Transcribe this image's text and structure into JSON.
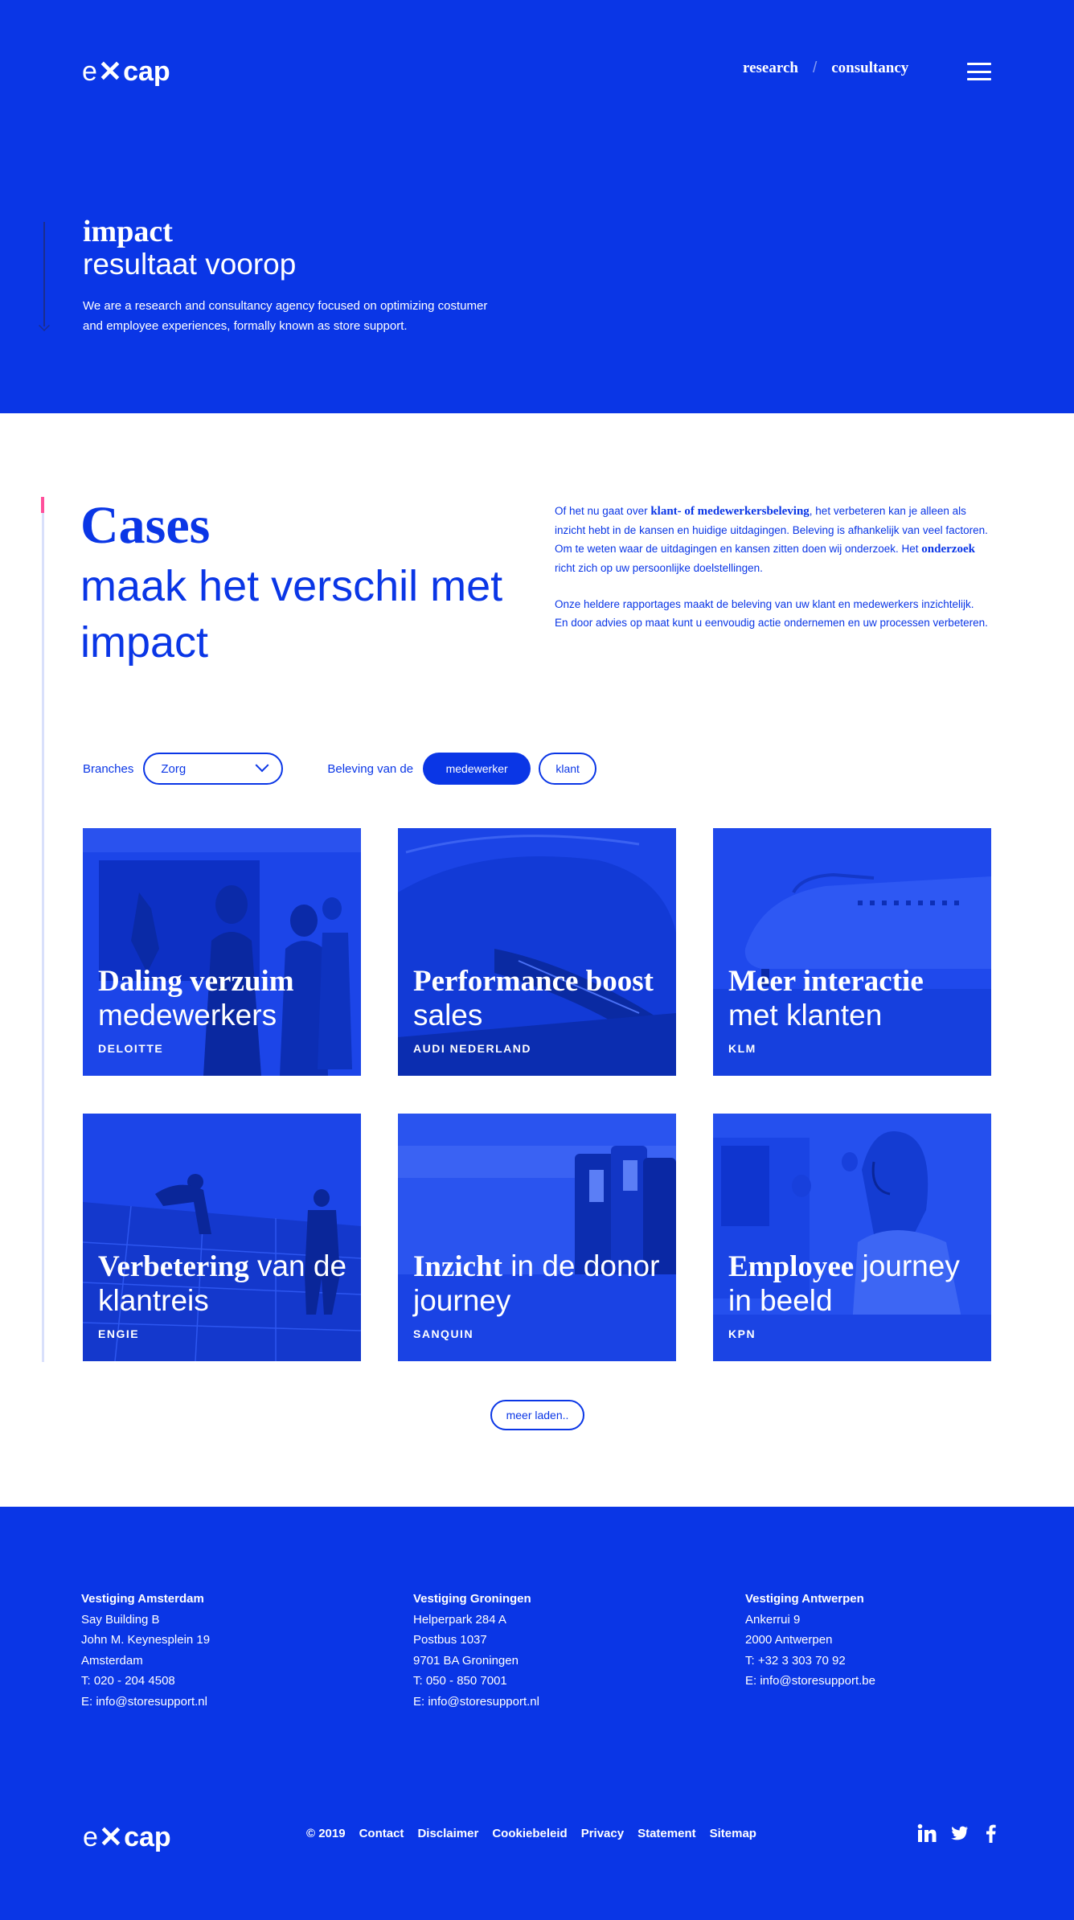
{
  "header": {
    "logo": {
      "e": "e",
      "x": "✕",
      "cap": "cap"
    },
    "nav": [
      {
        "label": "research"
      },
      {
        "label": "consultancy"
      }
    ],
    "nav_separator": "/"
  },
  "hero": {
    "title": "impact",
    "subtitle": "resultaat voorop",
    "text": "We are a research and consultancy agency focused on optimizing costumer and employee experiences, formally known as store support."
  },
  "cases": {
    "title": "Cases",
    "subtitle": "maak het verschil met impact",
    "intro1_a": "Of het nu gaat over ",
    "intro1_b": "klant- of medewerkersbeleving",
    "intro1_c": ", het verbeteren kan je alleen als inzicht hebt in de kansen en huidige uitdagingen. Beleving is afhankelijk van veel factoren. Om te weten waar de uitdagingen en kansen zitten doen wij onderzoek. Het ",
    "intro1_d": "onderzoek",
    "intro1_e": " richt zich op uw persoonlijke doelstellingen.",
    "intro2": "Onze heldere rapportages maakt de beleving van uw klant en medewerkers inzichtelijk. En door advies op maat kunt u eenvoudig actie ondernemen en uw processen verbeteren."
  },
  "filters": {
    "branches_label": "Branches",
    "branches_value": "Zorg",
    "beleving_label": "Beleving van de",
    "option_active": "medewerker",
    "option_other": "klant"
  },
  "cards": [
    {
      "bold": "Daling verzuim",
      "light": " medewerkers",
      "client": "DELOITTE"
    },
    {
      "bold": "Performance boost",
      "light": " sales",
      "client": "AUDI NEDERLAND"
    },
    {
      "bold": "Meer interactie",
      "light": " met klanten",
      "client": "KLM"
    },
    {
      "bold": "Verbetering",
      "light": " van de klantreis",
      "client": "ENGIE"
    },
    {
      "bold": "Inzicht",
      "light": " in de donor journey",
      "client": "SANQUIN"
    },
    {
      "bold": "Employee",
      "light": " journey in beeld",
      "client": "KPN"
    }
  ],
  "load_more": "meer laden..",
  "footer": {
    "offices": [
      {
        "name": "Vestiging Amsterdam",
        "lines": [
          "Say Building B",
          "John M. Keynesplein 19",
          "Amsterdam",
          "T: 020 - 204 4508",
          "E: info@storesupport.nl"
        ]
      },
      {
        "name": "Vestiging Groningen",
        "lines": [
          "Helperpark 284 A",
          "Postbus 1037",
          "9701 BA Groningen",
          "T: 050 - 850 7001",
          "E: info@storesupport.nl"
        ]
      },
      {
        "name": "Vestiging Antwerpen",
        "lines": [
          "Ankerrui 9",
          "2000 Antwerpen",
          "T: +32 3 303 70 92",
          "E: info@storesupport.be"
        ]
      }
    ],
    "links": [
      "© 2019",
      "Contact",
      "Disclaimer",
      "Cookiebeleid",
      "Privacy",
      "Statement",
      "Sitemap"
    ],
    "social": [
      "linkedin-icon",
      "twitter-icon",
      "facebook-icon"
    ]
  },
  "colors": {
    "brand_blue": "#0a36e6",
    "accent_pink": "#ff4f9b",
    "white": "#ffffff"
  }
}
